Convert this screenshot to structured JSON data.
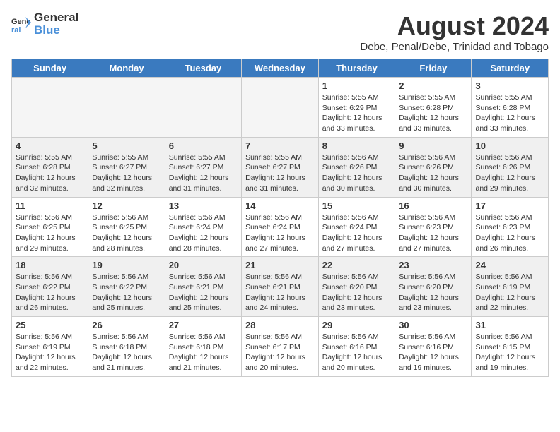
{
  "header": {
    "logo_general": "General",
    "logo_blue": "Blue",
    "month_title": "August 2024",
    "location": "Debe, Penal/Debe, Trinidad and Tobago"
  },
  "days_of_week": [
    "Sunday",
    "Monday",
    "Tuesday",
    "Wednesday",
    "Thursday",
    "Friday",
    "Saturday"
  ],
  "weeks": [
    {
      "shaded": false,
      "days": [
        {
          "number": "",
          "info": ""
        },
        {
          "number": "",
          "info": ""
        },
        {
          "number": "",
          "info": ""
        },
        {
          "number": "",
          "info": ""
        },
        {
          "number": "1",
          "info": "Sunrise: 5:55 AM\nSunset: 6:29 PM\nDaylight: 12 hours\nand 33 minutes."
        },
        {
          "number": "2",
          "info": "Sunrise: 5:55 AM\nSunset: 6:28 PM\nDaylight: 12 hours\nand 33 minutes."
        },
        {
          "number": "3",
          "info": "Sunrise: 5:55 AM\nSunset: 6:28 PM\nDaylight: 12 hours\nand 33 minutes."
        }
      ]
    },
    {
      "shaded": true,
      "days": [
        {
          "number": "4",
          "info": "Sunrise: 5:55 AM\nSunset: 6:28 PM\nDaylight: 12 hours\nand 32 minutes."
        },
        {
          "number": "5",
          "info": "Sunrise: 5:55 AM\nSunset: 6:27 PM\nDaylight: 12 hours\nand 32 minutes."
        },
        {
          "number": "6",
          "info": "Sunrise: 5:55 AM\nSunset: 6:27 PM\nDaylight: 12 hours\nand 31 minutes."
        },
        {
          "number": "7",
          "info": "Sunrise: 5:55 AM\nSunset: 6:27 PM\nDaylight: 12 hours\nand 31 minutes."
        },
        {
          "number": "8",
          "info": "Sunrise: 5:56 AM\nSunset: 6:26 PM\nDaylight: 12 hours\nand 30 minutes."
        },
        {
          "number": "9",
          "info": "Sunrise: 5:56 AM\nSunset: 6:26 PM\nDaylight: 12 hours\nand 30 minutes."
        },
        {
          "number": "10",
          "info": "Sunrise: 5:56 AM\nSunset: 6:26 PM\nDaylight: 12 hours\nand 29 minutes."
        }
      ]
    },
    {
      "shaded": false,
      "days": [
        {
          "number": "11",
          "info": "Sunrise: 5:56 AM\nSunset: 6:25 PM\nDaylight: 12 hours\nand 29 minutes."
        },
        {
          "number": "12",
          "info": "Sunrise: 5:56 AM\nSunset: 6:25 PM\nDaylight: 12 hours\nand 28 minutes."
        },
        {
          "number": "13",
          "info": "Sunrise: 5:56 AM\nSunset: 6:24 PM\nDaylight: 12 hours\nand 28 minutes."
        },
        {
          "number": "14",
          "info": "Sunrise: 5:56 AM\nSunset: 6:24 PM\nDaylight: 12 hours\nand 27 minutes."
        },
        {
          "number": "15",
          "info": "Sunrise: 5:56 AM\nSunset: 6:24 PM\nDaylight: 12 hours\nand 27 minutes."
        },
        {
          "number": "16",
          "info": "Sunrise: 5:56 AM\nSunset: 6:23 PM\nDaylight: 12 hours\nand 27 minutes."
        },
        {
          "number": "17",
          "info": "Sunrise: 5:56 AM\nSunset: 6:23 PM\nDaylight: 12 hours\nand 26 minutes."
        }
      ]
    },
    {
      "shaded": true,
      "days": [
        {
          "number": "18",
          "info": "Sunrise: 5:56 AM\nSunset: 6:22 PM\nDaylight: 12 hours\nand 26 minutes."
        },
        {
          "number": "19",
          "info": "Sunrise: 5:56 AM\nSunset: 6:22 PM\nDaylight: 12 hours\nand 25 minutes."
        },
        {
          "number": "20",
          "info": "Sunrise: 5:56 AM\nSunset: 6:21 PM\nDaylight: 12 hours\nand 25 minutes."
        },
        {
          "number": "21",
          "info": "Sunrise: 5:56 AM\nSunset: 6:21 PM\nDaylight: 12 hours\nand 24 minutes."
        },
        {
          "number": "22",
          "info": "Sunrise: 5:56 AM\nSunset: 6:20 PM\nDaylight: 12 hours\nand 23 minutes."
        },
        {
          "number": "23",
          "info": "Sunrise: 5:56 AM\nSunset: 6:20 PM\nDaylight: 12 hours\nand 23 minutes."
        },
        {
          "number": "24",
          "info": "Sunrise: 5:56 AM\nSunset: 6:19 PM\nDaylight: 12 hours\nand 22 minutes."
        }
      ]
    },
    {
      "shaded": false,
      "days": [
        {
          "number": "25",
          "info": "Sunrise: 5:56 AM\nSunset: 6:19 PM\nDaylight: 12 hours\nand 22 minutes."
        },
        {
          "number": "26",
          "info": "Sunrise: 5:56 AM\nSunset: 6:18 PM\nDaylight: 12 hours\nand 21 minutes."
        },
        {
          "number": "27",
          "info": "Sunrise: 5:56 AM\nSunset: 6:18 PM\nDaylight: 12 hours\nand 21 minutes."
        },
        {
          "number": "28",
          "info": "Sunrise: 5:56 AM\nSunset: 6:17 PM\nDaylight: 12 hours\nand 20 minutes."
        },
        {
          "number": "29",
          "info": "Sunrise: 5:56 AM\nSunset: 6:16 PM\nDaylight: 12 hours\nand 20 minutes."
        },
        {
          "number": "30",
          "info": "Sunrise: 5:56 AM\nSunset: 6:16 PM\nDaylight: 12 hours\nand 19 minutes."
        },
        {
          "number": "31",
          "info": "Sunrise: 5:56 AM\nSunset: 6:15 PM\nDaylight: 12 hours\nand 19 minutes."
        }
      ]
    }
  ]
}
